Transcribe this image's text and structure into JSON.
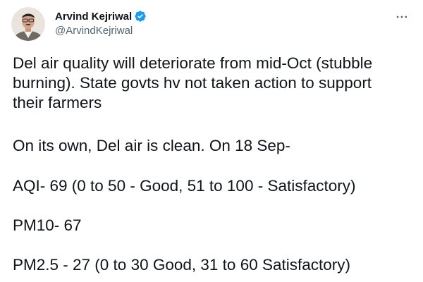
{
  "author": {
    "display_name": "Arvind Kejriwal",
    "handle": "@ArvindKejriwal",
    "verified": true
  },
  "icons": {
    "verified": "verified-badge-icon",
    "more": "more-horizontal-icon"
  },
  "colors": {
    "verified_blue": "#1d9bf0",
    "text_primary": "#0f1419",
    "text_secondary": "#536471"
  },
  "tweet": {
    "paragraphs": [
      "Del air quality will deteriorate from mid-Oct (stubble\nburning). State govts hv not taken action to support\ntheir farmers",
      "On its own, Del air is clean. On 18 Sep-",
      "AQI- 69 (0 to 50 - Good, 51 to 100 - Satisfactory)",
      "PM10- 67",
      "PM2.5 - 27 (0 to 30 Good, 31 to 60 Satisfactory)"
    ]
  }
}
